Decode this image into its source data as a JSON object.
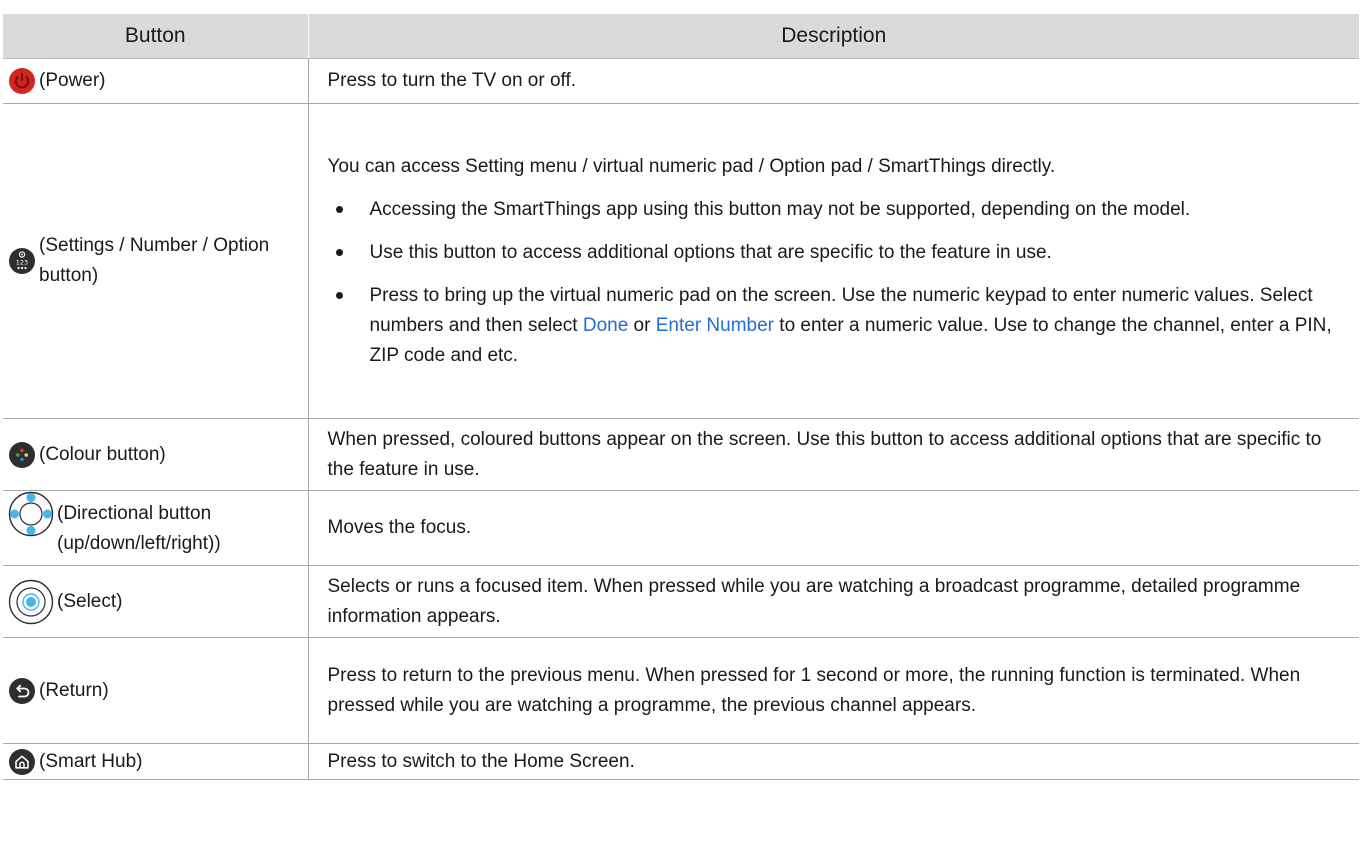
{
  "header": {
    "button_label": "Button",
    "description_label": "Description"
  },
  "rows": [
    {
      "button": "(Power)",
      "icon": "power-icon",
      "description": "Press to turn the TV on or off."
    },
    {
      "button": "(Settings / Number / Option button)",
      "icon": "settings-number-icon",
      "intro": "You can access Setting menu / virtual numeric pad / Option pad / SmartThings directly.",
      "bullets": [
        "Accessing the SmartThings app using this button may not be supported, depending on the model.",
        "Use this button to access additional options that are specific to the feature in use."
      ],
      "bullet3": {
        "part1": "Press to bring up the virtual numeric pad on the screen. Use the numeric keypad to enter numeric values. Select numbers and then select ",
        "done": "Done",
        "or": " or ",
        "enter_number": "Enter Number",
        "part2": " to enter a numeric value. Use to change the channel, enter a PIN, ZIP code and etc."
      }
    },
    {
      "button": "(Colour button)",
      "icon": "colour-button-icon",
      "description": "When pressed, coloured buttons appear on the screen. Use this button to access additional options that are specific to the feature in use."
    },
    {
      "button": "(Directional button (up/down/left/right))",
      "icon": "directional-button-icon",
      "description": "Moves the focus."
    },
    {
      "button": "(Select)",
      "icon": "select-icon",
      "description": "Selects or runs a focused item. When pressed while you are watching a broadcast programme, detailed programme information appears."
    },
    {
      "button": "(Return)",
      "icon": "return-icon",
      "description": "Press to return to the previous menu. When pressed for 1 second or more, the running function is terminated. When pressed while you are watching a programme, the previous channel appears."
    },
    {
      "button": "(Smart Hub)",
      "icon": "smart-hub-icon",
      "description": "Press to switch to the Home Screen."
    }
  ],
  "colors": {
    "header_bg": "#dadada",
    "highlight": "#1f6fd1",
    "power_red": "#d1261f",
    "icon_dark": "#2e2e2e",
    "directional_blue": "#45b5ec"
  }
}
